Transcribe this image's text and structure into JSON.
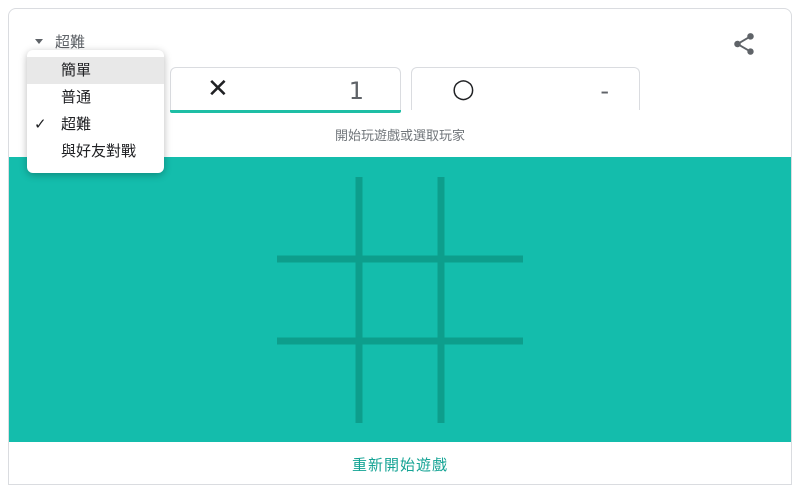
{
  "header": {
    "mode_label": "超難",
    "share_icon": "share-icon"
  },
  "scores": {
    "x": {
      "symbol": "✕",
      "value": "1"
    },
    "o": {
      "symbol": "○",
      "value": "-"
    }
  },
  "hint": "開始玩遊戲或選取玩家",
  "board": {
    "cells": [
      [
        "",
        "",
        ""
      ],
      [
        "",
        "",
        ""
      ],
      [
        "",
        "",
        ""
      ]
    ]
  },
  "footer": {
    "restart_label": "重新開始遊戲"
  },
  "menu": {
    "items": [
      {
        "label": "簡單"
      },
      {
        "label": "普通"
      },
      {
        "label": "超難",
        "check": "✓"
      },
      {
        "label": "與好友對戰"
      }
    ]
  },
  "colors": {
    "board": "#14bdac",
    "grid_lines": "#0d9e8c",
    "accent": "#1ebea5",
    "restart_text": "#14a394"
  }
}
